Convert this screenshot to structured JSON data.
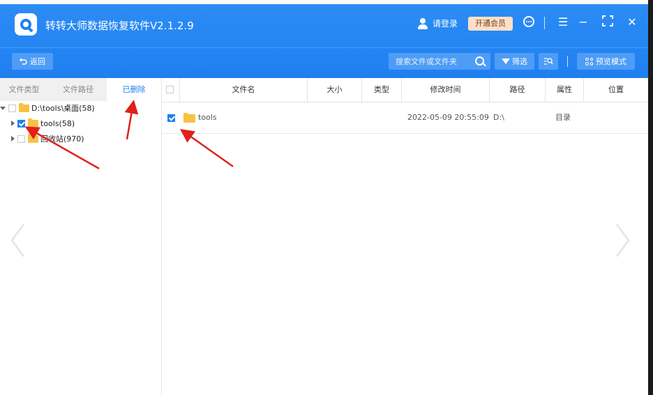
{
  "app": {
    "title": "转转大师数据恢复软件V2.1.2.9",
    "login_label": "请登录",
    "vip_label": "开通会员",
    "brand_color": "#1f80f0"
  },
  "window_controls": {
    "feedback_icon": "chat-icon",
    "menu_icon": "☰",
    "minimize_icon": "−",
    "maximize_icon": "⛶",
    "close_icon": "✕"
  },
  "toolbar": {
    "back_label": "返回",
    "search_placeholder": "搜索文件或文件夹",
    "filter_label": "筛选",
    "preview_label": "预览模式"
  },
  "left_panel": {
    "tabs": [
      {
        "label": "文件类型"
      },
      {
        "label": "文件路径"
      },
      {
        "label": "已删除"
      }
    ],
    "tree": [
      {
        "label": "D:\\tools\\桌面(58)",
        "checked": false,
        "expanded": true
      },
      {
        "label": "tools(58)",
        "checked": true,
        "expanded": false
      },
      {
        "label": "回收站(970)",
        "checked": false,
        "expanded": false
      }
    ]
  },
  "table": {
    "columns": [
      "文件名",
      "大小",
      "类型",
      "修改时间",
      "路径",
      "属性",
      "位置"
    ],
    "rows": [
      {
        "name": "tools",
        "size": "",
        "type": "",
        "modified": "2022-05-09 20:55:09",
        "path": "D:\\",
        "attr": "目录",
        "location": "",
        "checked": true
      }
    ]
  },
  "annotation_color": "#e0201b"
}
